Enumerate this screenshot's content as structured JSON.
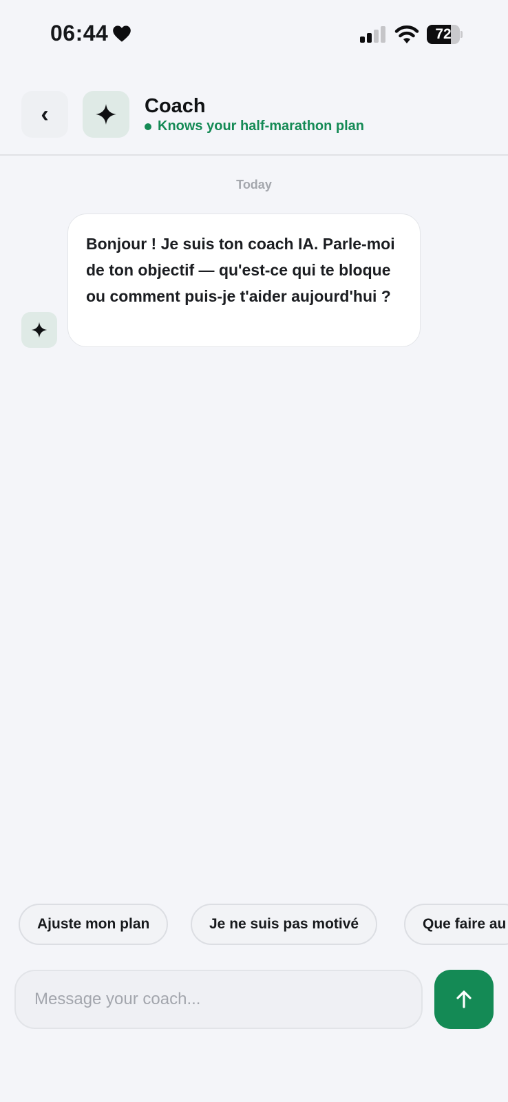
{
  "status_bar": {
    "time": "06:44",
    "battery_level": "72",
    "battery_fraction": 0.72
  },
  "header": {
    "back_icon": "‹",
    "avatar_icon": "sparkle-icon",
    "title": "Coach",
    "status": "Knows your half-marathon plan",
    "status_color": "#148a55"
  },
  "chat": {
    "date_label": "Today",
    "messages": [
      {
        "sender": "coach",
        "text": "Bonjour ! Je suis ton coach IA. Parle-moi de ton objectif — qu'est-ce qui te bloque ou comment puis-je t'aider aujourd'hui ?"
      }
    ]
  },
  "suggestions": [
    "Ajuste mon plan",
    "Je ne suis pas motivé",
    "Que faire au"
  ],
  "composer": {
    "placeholder": "Message your coach...",
    "send_icon": "arrow-up-icon",
    "accent_color": "#148a55"
  }
}
